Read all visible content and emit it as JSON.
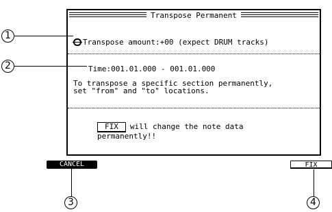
{
  "dialog": {
    "title": "Transpose Permanent",
    "transpose_line": "Transpose amount:+00 (expect DRUM tracks)",
    "time_line": "Time:001.01.000 - 001.01.000",
    "info_line1": "To transpose a specific section permanently,",
    "info_line2": "set \"from\" and \"to\" locations.",
    "fix_inline_label": "FIX",
    "fix_text1": "will change the note data",
    "fix_text2": "permanently!!"
  },
  "softkeys": {
    "cancel": "CANCEL",
    "fix": "FIX"
  },
  "callouts": {
    "c1": "1",
    "c2": "2",
    "c3": "3",
    "c4": "4"
  }
}
